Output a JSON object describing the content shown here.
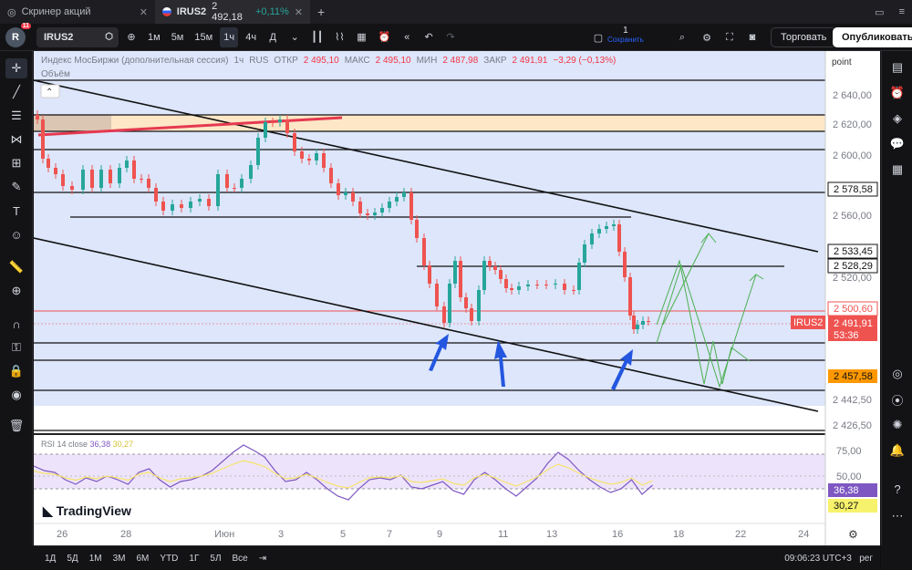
{
  "tabs": [
    {
      "title": "Скринер акций"
    },
    {
      "symbol": "IRUS2",
      "price": "2 492,18",
      "change": "+0,11%"
    }
  ],
  "toolbar": {
    "notif_count": "11",
    "avatar": "R",
    "symbol": "IRUS2",
    "intervals": [
      "1м",
      "5м",
      "15м",
      "1ч",
      "4ч",
      "Д"
    ],
    "active_interval": "1ч",
    "save_count": "1",
    "save_label": "Сохранить",
    "trade_label": "Торговать",
    "publish_label": "Опубликовать"
  },
  "legend": {
    "name": "Индекс МосБиржи (дополнительная сессия)",
    "interval": "1ч",
    "exchange": "RUS",
    "open_label": "ОТКР",
    "open": "2 495,10",
    "high_label": "МАКС",
    "high": "2 495,10",
    "low_label": "МИН",
    "low": "2 487,98",
    "close_label": "ЗАКР",
    "close": "2 491,91",
    "change": "−3,29 (−0,13%)",
    "volume_label": "Объём"
  },
  "price_axis": {
    "mode_label": "point",
    "ticks": [
      "2 640,00",
      "2 620,00",
      "2 600,00",
      "2 560,00",
      "2 520,00",
      "2 442,50",
      "2 426,50"
    ],
    "tags": [
      {
        "value": "2 578,58",
        "style": "white"
      },
      {
        "value": "2 533,45",
        "style": "white"
      },
      {
        "value": "2 528,29",
        "style": "white"
      },
      {
        "value": "2 500,60",
        "style": "red"
      },
      {
        "value": "2 491,91",
        "style": "red"
      },
      {
        "value": "53:36",
        "style": "red"
      },
      {
        "value": "2 457,58",
        "style": "orange"
      }
    ],
    "symbol_tag": "IRUS2"
  },
  "rsi": {
    "label": "RSI 14 close",
    "value1": "36,38",
    "value2": "30,27",
    "ticks": [
      "75,00",
      "50,00"
    ]
  },
  "time_axis": [
    "26",
    "28",
    "Июн",
    "3",
    "5",
    "7",
    "9",
    "11",
    "13",
    "16",
    "18",
    "22",
    "24"
  ],
  "watermark": "TradingView",
  "bottom": {
    "ranges": [
      "1Д",
      "5Д",
      "1М",
      "3М",
      "6М",
      "YTD",
      "1Г",
      "5Л",
      "Все"
    ],
    "time": "09:06:23 UTC+3",
    "mode": "рег"
  },
  "colors": {
    "up": "#26a69a",
    "down": "#ef5350",
    "channel_fill": "#dde6fb",
    "accent": "#2962ff"
  }
}
